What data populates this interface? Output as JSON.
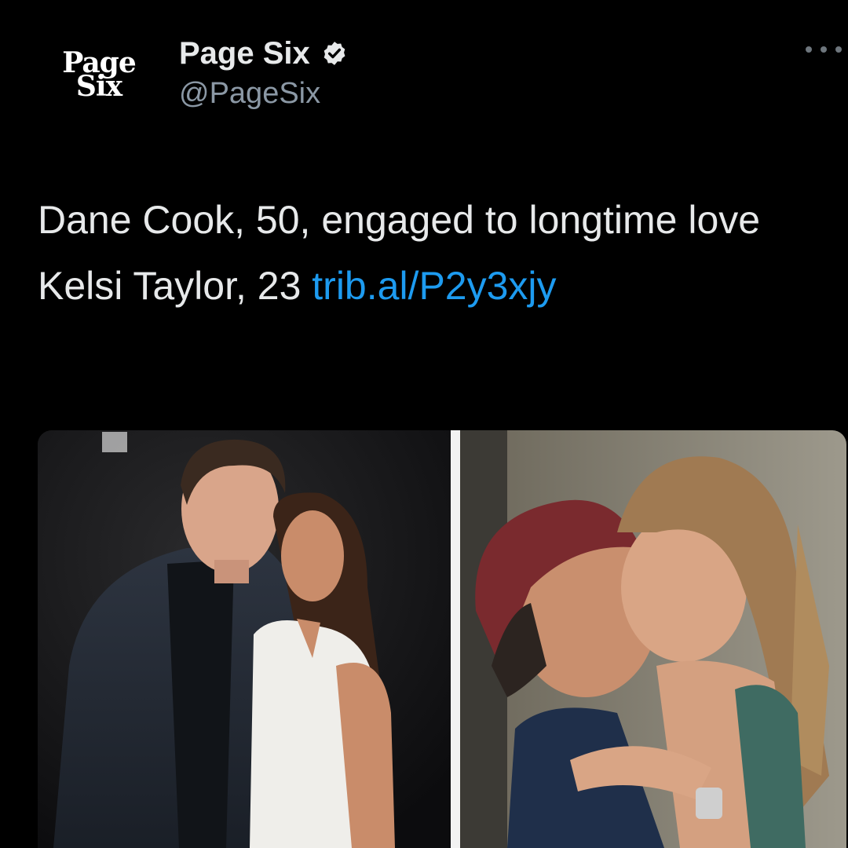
{
  "account": {
    "logo_line1": "Page",
    "logo_line2": "Six",
    "display_name": "Page Six",
    "handle": "@PageSix",
    "verified": true
  },
  "tweet": {
    "text": "Dane Cook, 50, engaged to longtime love Kelsi Taylor, 23 ",
    "link": "trib.al/P2y3xjy"
  },
  "icons": {
    "verified": "verified-badge-icon",
    "more": "more-dots-icon"
  },
  "colors": {
    "background": "#000000",
    "text": "#e7e9ea",
    "link": "#1d9bf0",
    "secondary": "#8b98a5"
  }
}
